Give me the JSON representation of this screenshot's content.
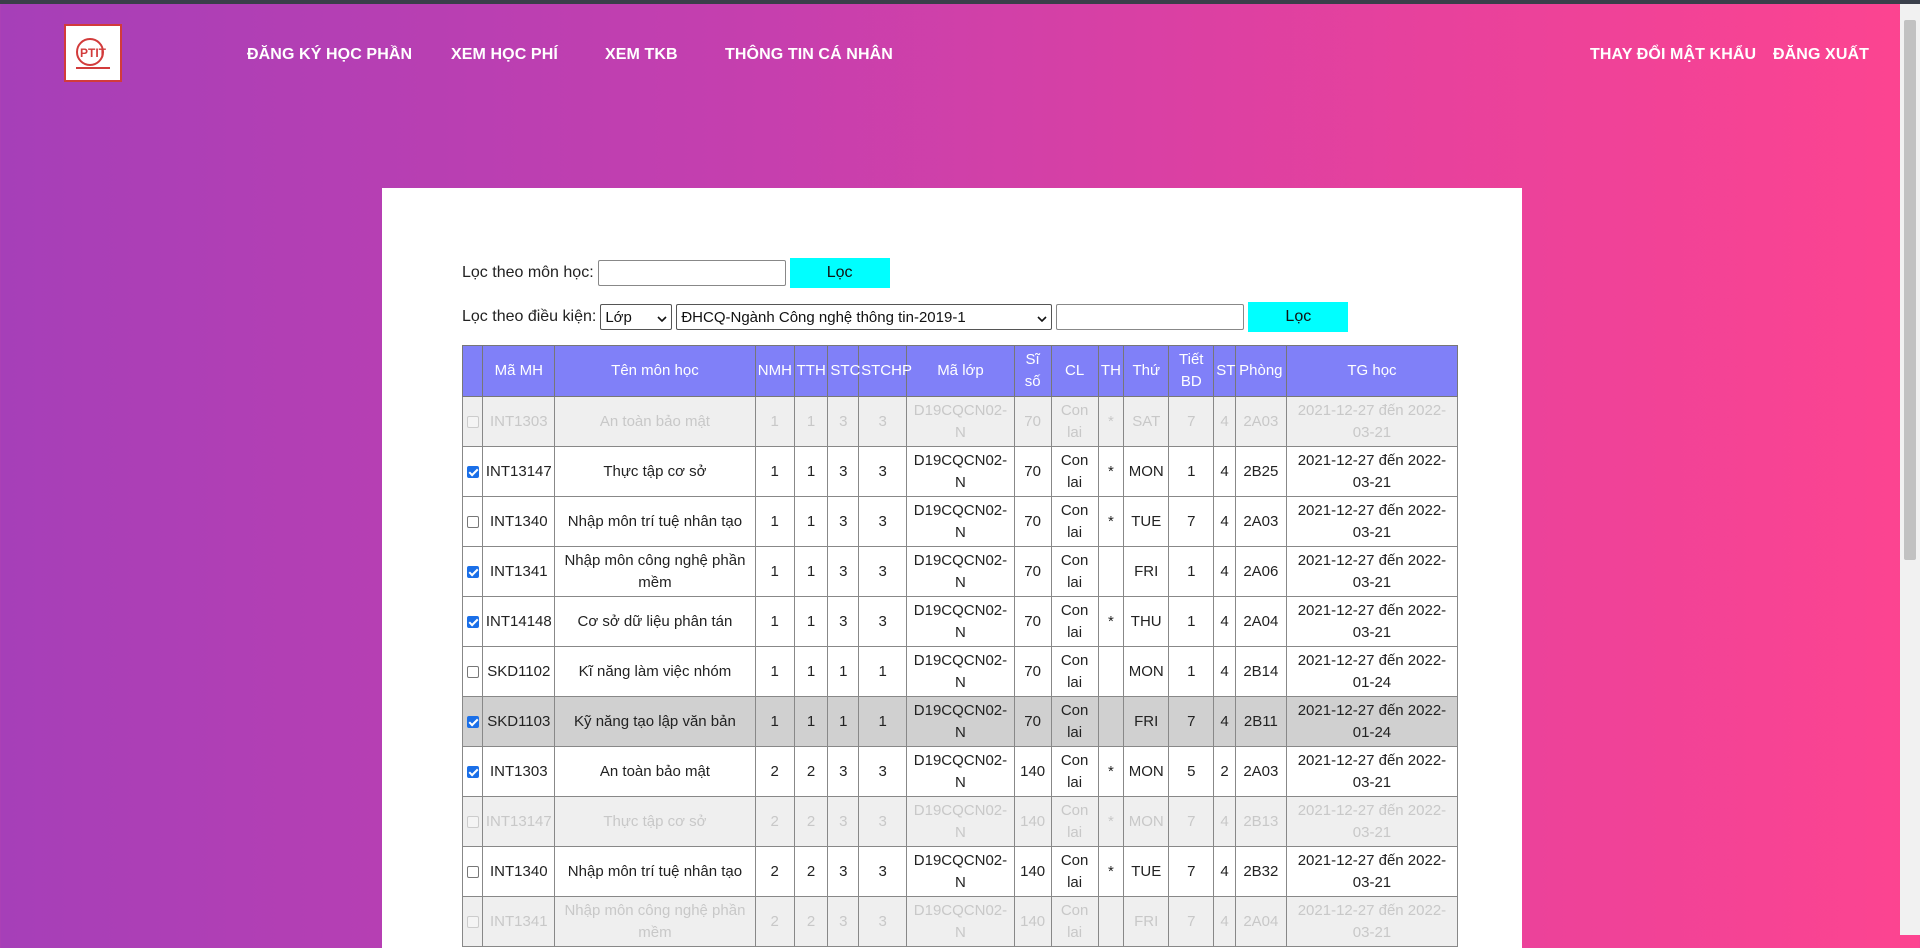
{
  "nav": {
    "logo_text": "PTIT",
    "links_left": [
      "ĐĂNG KÝ HỌC PHẦN",
      "XEM HỌC PHÍ",
      "XEM TKB",
      "THÔNG TIN CÁ NHÂN"
    ],
    "links_right": [
      "THAY ĐỔI MẬT KHẨU",
      "ĐĂNG XUẤT"
    ]
  },
  "filter1": {
    "label": "Lọc theo môn học:",
    "input_value": "",
    "button": "Lọc"
  },
  "filter2": {
    "label": "Lọc theo điều kiện:",
    "type_select": "Lớp",
    "class_select": "ĐHCQ-Ngành Công nghệ thông tin-2019-1",
    "input_value": "",
    "button": "Lọc"
  },
  "table": {
    "headers": [
      "",
      "Mã MH",
      "Tên môn học",
      "NMH",
      "TTH",
      "STC",
      "STCHP",
      "Mã lớp",
      "Sĩ số",
      "CL",
      "TH",
      "Thứ",
      "Tiết BD",
      "ST",
      "Phòng",
      "TG học"
    ],
    "rows": [
      {
        "state": "disabled",
        "checked": false,
        "cells": [
          "INT1303",
          "An toàn bảo mật",
          "1",
          "1",
          "3",
          "3",
          "D19CQCN02-N",
          "70",
          "Con lai",
          "*",
          "SAT",
          "7",
          "4",
          "2A03",
          "2021-12-27 đến 2022-03-21"
        ]
      },
      {
        "state": "normal",
        "checked": true,
        "cells": [
          "INT13147",
          "Thực tập cơ sở",
          "1",
          "1",
          "3",
          "3",
          "D19CQCN02-N",
          "70",
          "Con lai",
          "*",
          "MON",
          "1",
          "4",
          "2B25",
          "2021-12-27 đến 2022-03-21"
        ]
      },
      {
        "state": "normal",
        "checked": false,
        "cells": [
          "INT1340",
          "Nhập môn trí tuệ nhân tạo",
          "1",
          "1",
          "3",
          "3",
          "D19CQCN02-N",
          "70",
          "Con lai",
          "*",
          "TUE",
          "7",
          "4",
          "2A03",
          "2021-12-27 đến 2022-03-21"
        ]
      },
      {
        "state": "normal",
        "checked": true,
        "cells": [
          "INT1341",
          "Nhập môn công nghệ phần mềm",
          "1",
          "1",
          "3",
          "3",
          "D19CQCN02-N",
          "70",
          "Con lai",
          "",
          "FRI",
          "1",
          "4",
          "2A06",
          "2021-12-27 đến 2022-03-21"
        ]
      },
      {
        "state": "normal",
        "checked": true,
        "cells": [
          "INT14148",
          "Cơ sở dữ liệu phân tán",
          "1",
          "1",
          "3",
          "3",
          "D19CQCN02-N",
          "70",
          "Con lai",
          "*",
          "THU",
          "1",
          "4",
          "2A04",
          "2021-12-27 đến 2022-03-21"
        ]
      },
      {
        "state": "normal",
        "checked": false,
        "cells": [
          "SKD1102",
          "Kĩ năng làm việc nhóm",
          "1",
          "1",
          "1",
          "1",
          "D19CQCN02-N",
          "70",
          "Con lai",
          "",
          "MON",
          "1",
          "4",
          "2B14",
          "2021-12-27 đến 2022-01-24"
        ]
      },
      {
        "state": "highlight",
        "checked": true,
        "cells": [
          "SKD1103",
          "Kỹ năng tạo lập văn bản",
          "1",
          "1",
          "1",
          "1",
          "D19CQCN02-N",
          "70",
          "Con lai",
          "",
          "FRI",
          "7",
          "4",
          "2B11",
          "2021-12-27 đến 2022-01-24"
        ]
      },
      {
        "state": "normal",
        "checked": true,
        "cells": [
          "INT1303",
          "An toàn bảo mật",
          "2",
          "2",
          "3",
          "3",
          "D19CQCN02-N",
          "140",
          "Con lai",
          "*",
          "MON",
          "5",
          "2",
          "2A03",
          "2021-12-27 đến 2022-03-21"
        ]
      },
      {
        "state": "disabled",
        "checked": false,
        "cells": [
          "INT13147",
          "Thực tập cơ sở",
          "2",
          "2",
          "3",
          "3",
          "D19CQCN02-N",
          "140",
          "Con lai",
          "*",
          "MON",
          "7",
          "4",
          "2B13",
          "2021-12-27 đến 2022-03-21"
        ]
      },
      {
        "state": "normal",
        "checked": false,
        "cells": [
          "INT1340",
          "Nhập môn trí tuệ nhân tạo",
          "2",
          "2",
          "3",
          "3",
          "D19CQCN02-N",
          "140",
          "Con lai",
          "*",
          "TUE",
          "7",
          "4",
          "2B32",
          "2021-12-27 đến 2022-03-21"
        ]
      },
      {
        "state": "disabled",
        "checked": false,
        "cells": [
          "INT1341",
          "Nhập môn công nghệ phần mềm",
          "2",
          "2",
          "3",
          "3",
          "D19CQCN02-N",
          "140",
          "Con lai",
          "",
          "FRI",
          "7",
          "4",
          "2A04",
          "2021-12-27 đến 2022-03-21"
        ]
      }
    ]
  },
  "colors": {
    "header_bg": "#8080f8",
    "button_bg": "#00ffff",
    "gradient_start": "#a63fb8",
    "gradient_end": "#fd4490"
  }
}
